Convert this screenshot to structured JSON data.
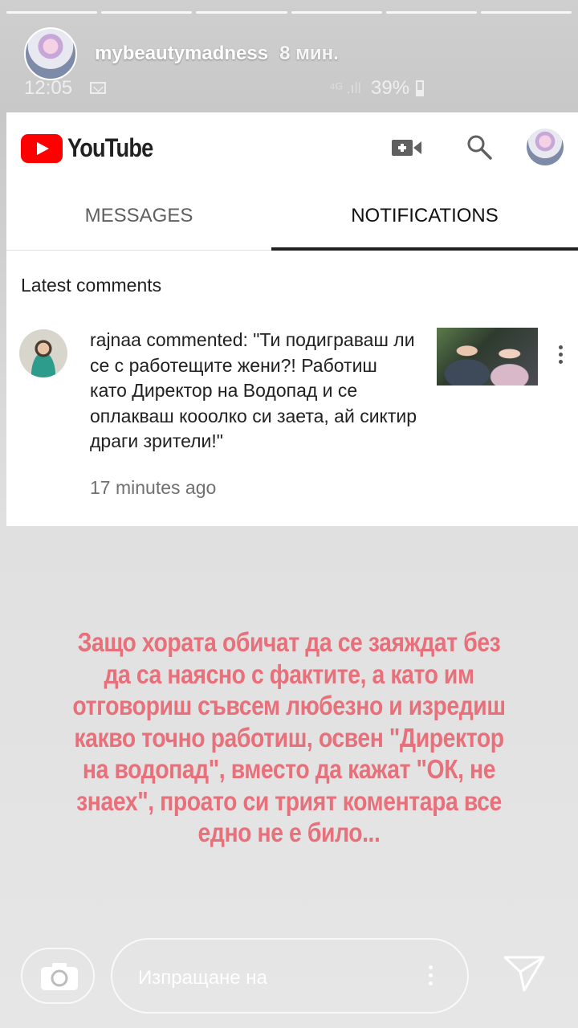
{
  "story": {
    "username": "mybeautymadness",
    "time_ago": "8 мин.",
    "progress_segments": 6
  },
  "phone_status": {
    "time": "12:05",
    "signal": "⁴ᴳ .ıll",
    "battery": "39%"
  },
  "youtube": {
    "logo_text": "YouTube",
    "tabs": [
      {
        "label": "MESSAGES",
        "selected": false
      },
      {
        "label": "NOTIFICATIONS",
        "selected": true
      }
    ],
    "section_title": "Latest comments",
    "notification": {
      "text": "rajnaa commented: \"Ти подиграваш ли се с работещите жени?! Работиш като Директор на Водопад и се оплакваш кооолко си заета, ай сиктир драги зрители!\"",
      "time": "17 minutes ago"
    }
  },
  "overlay": {
    "text": "Защо хората обичат да се заяждат без да са наясно с фактите, а като им отговориш съвсем любезно и изредиш какво точно работиш, освен \"Директор на водопад\", вместо да кажат \"ОК, не знаех\", проато си трият коментара все едно не е било...",
    "color": "#e8707a"
  },
  "reply": {
    "placeholder": "Изпращане на"
  },
  "colors": {
    "youtube_red": "#ff0000",
    "tab_indicator": "#212121"
  },
  "icons": [
    "camera-video-icon",
    "search-icon",
    "more-vert-icon",
    "camera-icon",
    "send-icon",
    "mail-icon",
    "battery-icon"
  ]
}
